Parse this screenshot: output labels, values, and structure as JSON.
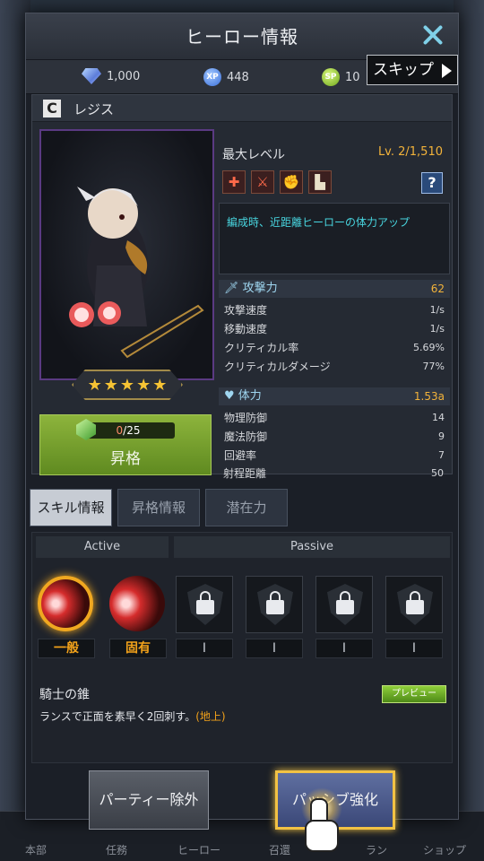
{
  "header": {
    "title": "ヒーロー情報"
  },
  "skip": {
    "label": "スキップ"
  },
  "currency": {
    "gems": "1,000",
    "xp": "448",
    "sp": "10",
    "xp_badge": "XP",
    "sp_badge": "SP"
  },
  "hero": {
    "rank": "C",
    "name": "レジス",
    "max_level_label": "最大レベル",
    "max_level_value": "Lv. 2/1,510",
    "stars": 5,
    "description": "編成時、近距離ヒーローの体力アップ",
    "ascend": {
      "progress_current": "0",
      "progress_total": "/25",
      "label": "昇格"
    },
    "attack": {
      "label": "攻撃力",
      "value": "62",
      "rows": [
        {
          "label": "攻撃速度",
          "value": "1/s"
        },
        {
          "label": "移動速度",
          "value": "1/s"
        },
        {
          "label": "クリティカル率",
          "value": "5.69%"
        },
        {
          "label": "クリティカルダメージ",
          "value": "77%"
        }
      ]
    },
    "health": {
      "label": "体力",
      "value": "1.53a",
      "rows": [
        {
          "label": "物理防御",
          "value": "14"
        },
        {
          "label": "魔法防御",
          "value": "9"
        },
        {
          "label": "回避率",
          "value": "7"
        },
        {
          "label": "射程距離",
          "value": "50"
        }
      ]
    }
  },
  "tabs": [
    {
      "label": "スキル情報",
      "active": true
    },
    {
      "label": "昇格情報",
      "active": false
    },
    {
      "label": "潜在力",
      "active": false
    }
  ],
  "skills": {
    "active_label": "Active",
    "passive_label": "Passive",
    "captions": [
      "一般",
      "固有",
      "I",
      "I",
      "I",
      "I"
    ],
    "selected_name": "騎士の錐",
    "preview_label": "プレビュー",
    "selected_desc": "ランスで正面を素早く2回刺す。",
    "selected_tag": "(地上)"
  },
  "buttons": {
    "party_remove": "パーティー除外",
    "passive_enhance": "パッシブ強化"
  },
  "bottom_nav": [
    "本部",
    "任務",
    "ヒーロー",
    "召還",
    "ラン",
    "ショップ"
  ],
  "colors": {
    "accent_gold": "#f3b33a",
    "ascend_green": "#6f9a2a",
    "desc_cyan": "#48d6e0"
  }
}
